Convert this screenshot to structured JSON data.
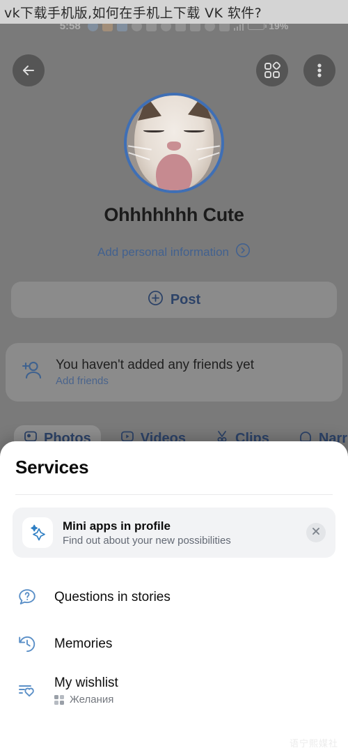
{
  "page_title": "vk下载手机版,如何在手机上下载 VK 软件?",
  "statusbar": {
    "time": "5:58",
    "battery_percent": "19%",
    "icons": [
      "message-icon",
      "photo-icon",
      "app-icon",
      "dnd-icon",
      "cast-icon",
      "eye-icon",
      "sim-icon",
      "bluetooth-icon",
      "location-icon",
      "vibrate-icon",
      "signal-icon",
      "battery-icon"
    ]
  },
  "profile": {
    "back_icon": "arrow-left-icon",
    "services_icon": "grid-apps-icon",
    "more_icon": "more-vertical-icon",
    "avatar_alt": "cat-avatar",
    "avatar_ring_color": "#3f6fb5",
    "name": "Ohhhhhhh Cute",
    "add_info_label": "Add personal information",
    "add_info_icon": "chevron-right-circle-icon",
    "post_label": "Post",
    "post_icon": "plus-circle-icon",
    "friends": {
      "icon": "add-person-icon",
      "title": "You haven't added any friends yet",
      "link": "Add friends"
    },
    "tabs": [
      {
        "label": "Photos",
        "icon": "photo-icon",
        "active": true
      },
      {
        "label": "Videos",
        "icon": "video-icon",
        "active": false
      },
      {
        "label": "Clips",
        "icon": "clips-icon",
        "active": false
      },
      {
        "label": "Narr",
        "icon": "narratives-icon",
        "active": false
      }
    ]
  },
  "sheet": {
    "title": "Services",
    "promo": {
      "icon": "sparkle-icon",
      "title": "Mini apps in profile",
      "subtitle": "Find out about your new possibilities",
      "close_icon": "close-icon"
    },
    "items": [
      {
        "label": "Questions in stories",
        "icon": "question-bubble-icon",
        "subtitle": ""
      },
      {
        "label": "Memories",
        "icon": "history-clock-icon",
        "subtitle": ""
      },
      {
        "label": "My wishlist",
        "icon": "wishlist-heart-icon",
        "subtitle": "Желания",
        "subtitle_icon": "mini-app-grid-icon"
      }
    ]
  },
  "watermark": "语宁熙媒社",
  "colors": {
    "accent_blue": "#3f6fb5",
    "link_blue": "#42618f",
    "icon_blue": "#5a8fc7",
    "sheet_bg": "#ffffff",
    "promo_bg": "#f2f3f5",
    "backdrop": "#878787"
  }
}
